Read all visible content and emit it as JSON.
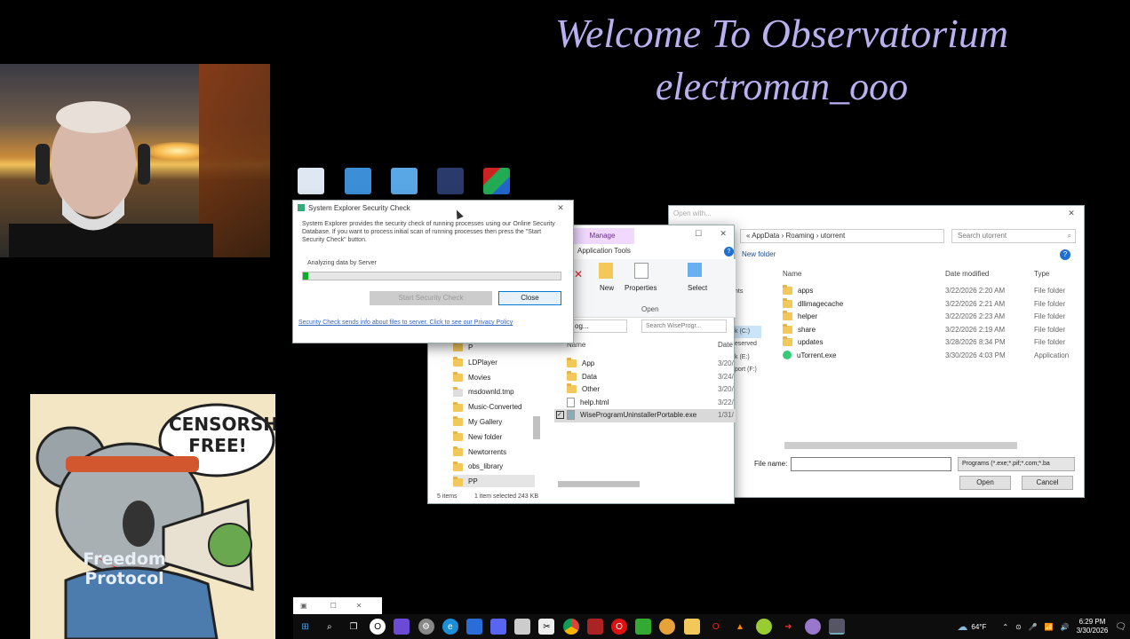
{
  "banner": {
    "line1": "Welcome To Observatorium",
    "line2": "electroman_ooo"
  },
  "desktop_icons": [
    "recycle-bin-icon",
    "network-icon",
    "control-panel-icon",
    "video-editor-icon",
    "winrar-icon"
  ],
  "security_dialog": {
    "title": "System Explorer Security Check",
    "description": "System Explorer provides the security check of running processes using our Online Security Database. If you want to process initial scan of running processes then press the \"Start Security Check\" button.",
    "status": "Analyzing data by Server",
    "progress": 0.02,
    "start_label": "Start Security Check",
    "close_label": "Close",
    "footer_link": "Security Check sends info about files to server. Click to see our Privacy Policy"
  },
  "explorer": {
    "manage_tab": "Manage",
    "app_tools": "Application Tools",
    "ribbon": {
      "new_label": "New",
      "properties_label": "Properties",
      "select_label": "Select",
      "open_group": "Open"
    },
    "address": "og...",
    "search_placeholder": "Search WiseProgr...",
    "col_name": "Name",
    "col_date": "Date",
    "sidebar_items": [
      "P",
      "LDPlayer",
      "Movies",
      "msdownld.tmp",
      "Music-Converted",
      "My Gallery",
      "New folder",
      "Newtorrents",
      "obs_library",
      "PP"
    ],
    "files": [
      {
        "name": "App",
        "date": "3/20/",
        "kind": "folder"
      },
      {
        "name": "Data",
        "date": "3/24/",
        "kind": "folder"
      },
      {
        "name": "Other",
        "date": "3/20/",
        "kind": "folder"
      },
      {
        "name": "help.html",
        "date": "3/22/",
        "kind": "file"
      },
      {
        "name": "WiseProgramUninstallerPortable.exe",
        "date": "1/31/",
        "kind": "exe"
      }
    ],
    "status_items": "5 items",
    "status_selected": "1 item selected  243 KB"
  },
  "open_dialog": {
    "title": "Open with...",
    "breadcrumb": [
      "AppData",
      "Roaming",
      "utorrent"
    ],
    "search_placeholder": "Search utorrent",
    "new_folder": "New folder",
    "nav_partial": [
      "nts",
      "k (C:)",
      "eserved",
      "k (E:)",
      "port (F:)"
    ],
    "columns": {
      "name": "Name",
      "date": "Date modified",
      "type": "Type"
    },
    "rows": [
      {
        "name": "apps",
        "date": "3/22/2026 2:20 AM",
        "type": "File folder",
        "kind": "folder"
      },
      {
        "name": "dllimagecache",
        "date": "3/22/2026 2:21 AM",
        "type": "File folder",
        "kind": "folder"
      },
      {
        "name": "helper",
        "date": "3/22/2026 2:23 AM",
        "type": "File folder",
        "kind": "folder"
      },
      {
        "name": "share",
        "date": "3/22/2026 2:19 AM",
        "type": "File folder",
        "kind": "folder"
      },
      {
        "name": "updates",
        "date": "3/28/2026 8:34 PM",
        "type": "File folder",
        "kind": "folder"
      },
      {
        "name": "uTorrent.exe",
        "date": "3/30/2026 4:03 PM",
        "type": "Application",
        "kind": "exe"
      }
    ],
    "file_name_label": "File name:",
    "file_name_value": "",
    "filter": "Programs (*.exe;*.pif;*.com;*.ba",
    "open_label": "Open",
    "cancel_label": "Cancel"
  },
  "meme": {
    "bubble_line1": "CENSORSHIP",
    "bubble_line2": "FREE!",
    "shirt_line1": "Freedom",
    "shirt_line2": "Protocol"
  },
  "taskbar": {
    "weather": "64°F",
    "time": "6:29 PM",
    "date": "3/30/2026",
    "apps": [
      "start-icon",
      "search-icon",
      "task-view-icon",
      "opera-icon",
      "app-icon",
      "settings-icon",
      "edge-icon",
      "app-icon",
      "discord-icon",
      "store-icon",
      "capcut-icon",
      "chrome-icon",
      "app-icon",
      "opera-icon",
      "app-icon",
      "app-icon",
      "explorer-icon",
      "opera-gx-icon",
      "vlc-icon",
      "app-icon",
      "app-icon",
      "app-icon",
      "system-explorer-icon"
    ]
  }
}
